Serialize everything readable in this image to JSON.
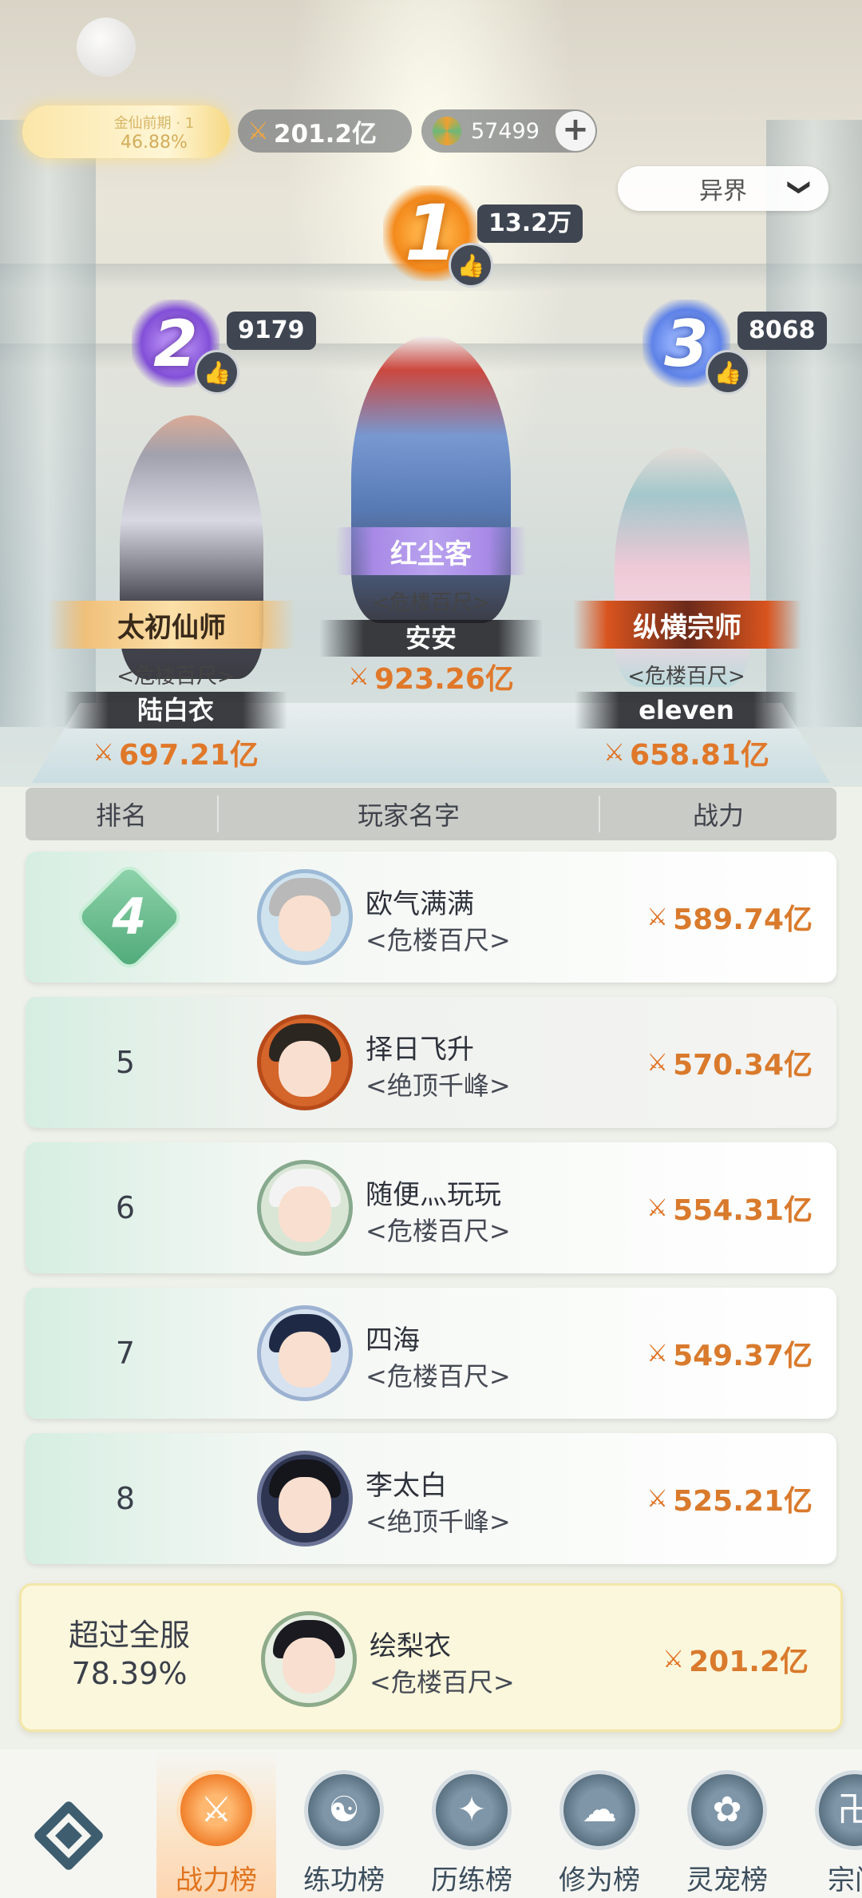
{
  "status_bar": {
    "realm_label": "金仙前期 · 1",
    "realm_progress": "46.88%",
    "my_power": "201.2亿",
    "currency": "57499",
    "plus_label": "+"
  },
  "server_select": {
    "value": "异界",
    "chevron": "❯"
  },
  "podium": {
    "first": {
      "rank": "1",
      "likes": "13.2万",
      "title": "红尘客",
      "sect": "<危楼百尺>",
      "name": "安安",
      "power": "923.26亿"
    },
    "second": {
      "rank": "2",
      "likes": "9179",
      "title": "太初仙师",
      "sect": "<危楼百尺>",
      "name": "陆白衣",
      "power": "697.21亿"
    },
    "third": {
      "rank": "3",
      "likes": "8068",
      "title": "纵横宗师",
      "sect": "<危楼百尺>",
      "name": "eleven",
      "power": "658.81亿"
    }
  },
  "table": {
    "headers": {
      "rank": "排名",
      "name": "玩家名字",
      "power": "战力"
    },
    "rows": [
      {
        "rank": "4",
        "name": "欧气满满",
        "sect": "<危楼百尺>",
        "power": "589.74亿"
      },
      {
        "rank": "5",
        "name": "择日飞升",
        "sect": "<绝顶千峰>",
        "power": "570.34亿"
      },
      {
        "rank": "6",
        "name": "随便灬玩玩",
        "sect": "<危楼百尺>",
        "power": "554.31亿"
      },
      {
        "rank": "7",
        "name": "四海",
        "sect": "<危楼百尺>",
        "power": "549.37亿"
      },
      {
        "rank": "8",
        "name": "李太白",
        "sect": "<绝顶千峰>",
        "power": "525.21亿"
      }
    ]
  },
  "self_row": {
    "exceed_label": "超过全服",
    "exceed_value": "78.39%",
    "name": "绘梨衣",
    "sect": "<危楼百尺>",
    "power": "201.2亿"
  },
  "bottom_nav": {
    "items": [
      {
        "label": "战力榜",
        "icon": "⚔"
      },
      {
        "label": "练功榜",
        "icon": "☯"
      },
      {
        "label": "历练榜",
        "icon": "✦"
      },
      {
        "label": "修为榜",
        "icon": "☁"
      },
      {
        "label": "灵宠榜",
        "icon": "✿"
      },
      {
        "label": "宗门",
        "icon": "卍"
      }
    ]
  },
  "icons": {
    "power": "⚔",
    "like": "👍"
  },
  "colors": {
    "power_orange": "#d97a2c",
    "active_tab": "#e0741e",
    "rank_1": "#f48a1c",
    "rank_2": "#8250d8",
    "rank_3": "#5f83e8"
  }
}
